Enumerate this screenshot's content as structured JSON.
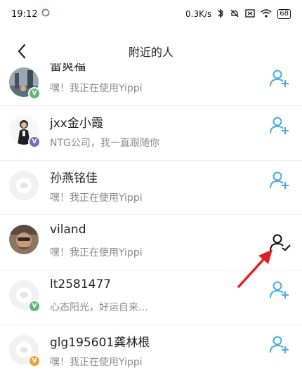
{
  "status_bar": {
    "time": "19:12",
    "network_speed": "0.3K/s",
    "battery": "68"
  },
  "header": {
    "title": "附近的人"
  },
  "accent_color": "#4aa9e6",
  "rows": [
    {
      "name": "雷爽福",
      "status": "嘿！我正在使用Yippi",
      "badge": "V",
      "badge_color": "#62b57b",
      "avatar": "photo",
      "action": "add"
    },
    {
      "name": "jxx金小霞",
      "status": "NTG公司，我一直跟随你",
      "badge": "V",
      "badge_color": "#7b68c7",
      "avatar": "photo",
      "action": "add"
    },
    {
      "name": "孙燕铭佳",
      "status": "嘿！我正在使用Yippi",
      "badge": "",
      "badge_color": "",
      "avatar": "default",
      "action": "add"
    },
    {
      "name": "viland",
      "status": "嘿！我正在使用Yippi",
      "badge": "",
      "badge_color": "",
      "avatar": "photo",
      "action": "added"
    },
    {
      "name": "lt2581477",
      "status": "心态阳光，好运自来…",
      "badge": "V",
      "badge_color": "#62b57b",
      "avatar": "default",
      "action": "add"
    },
    {
      "name": "glg195601龚林根",
      "status": "嘿！我正在使用Yippi",
      "badge": "V",
      "badge_color": "#e6a23c",
      "avatar": "default",
      "action": "add"
    }
  ]
}
